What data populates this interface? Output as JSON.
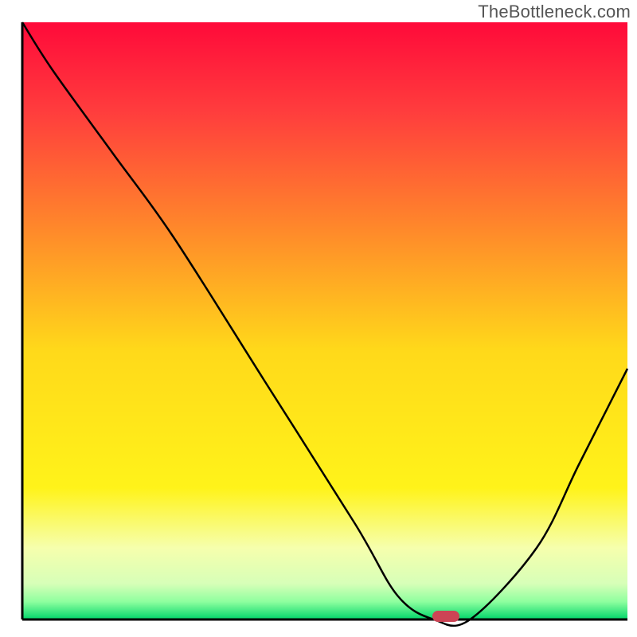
{
  "watermark": "TheBottleneck.com",
  "chart_data": {
    "type": "line",
    "title": "",
    "xlabel": "",
    "ylabel": "",
    "xlim": [
      0,
      100
    ],
    "ylim": [
      0,
      100
    ],
    "axes_visible": {
      "left": true,
      "bottom": true,
      "ticks": false,
      "labels": false
    },
    "grid": false,
    "background_gradient": {
      "orientation": "vertical",
      "stops": [
        {
          "pos": 0.0,
          "color": "#ff0a3a"
        },
        {
          "pos": 0.15,
          "color": "#ff3d3d"
        },
        {
          "pos": 0.35,
          "color": "#ff8a2a"
        },
        {
          "pos": 0.55,
          "color": "#ffd91a"
        },
        {
          "pos": 0.78,
          "color": "#fff31a"
        },
        {
          "pos": 0.88,
          "color": "#f6ffad"
        },
        {
          "pos": 0.94,
          "color": "#d7ffb8"
        },
        {
          "pos": 0.97,
          "color": "#8fff9f"
        },
        {
          "pos": 1.0,
          "color": "#00d66a"
        }
      ]
    },
    "series": [
      {
        "name": "bottleneck-curve",
        "x": [
          0,
          5,
          15,
          25,
          40,
          55,
          62,
          68,
          74,
          85,
          92,
          100
        ],
        "y": [
          100,
          92,
          78,
          64,
          40,
          16,
          4,
          0,
          0,
          12,
          26,
          42
        ]
      }
    ],
    "marker": {
      "name": "optimal-point",
      "x": 70,
      "y": 0,
      "color": "#cc4455",
      "shape": "pill"
    },
    "legend": null
  }
}
